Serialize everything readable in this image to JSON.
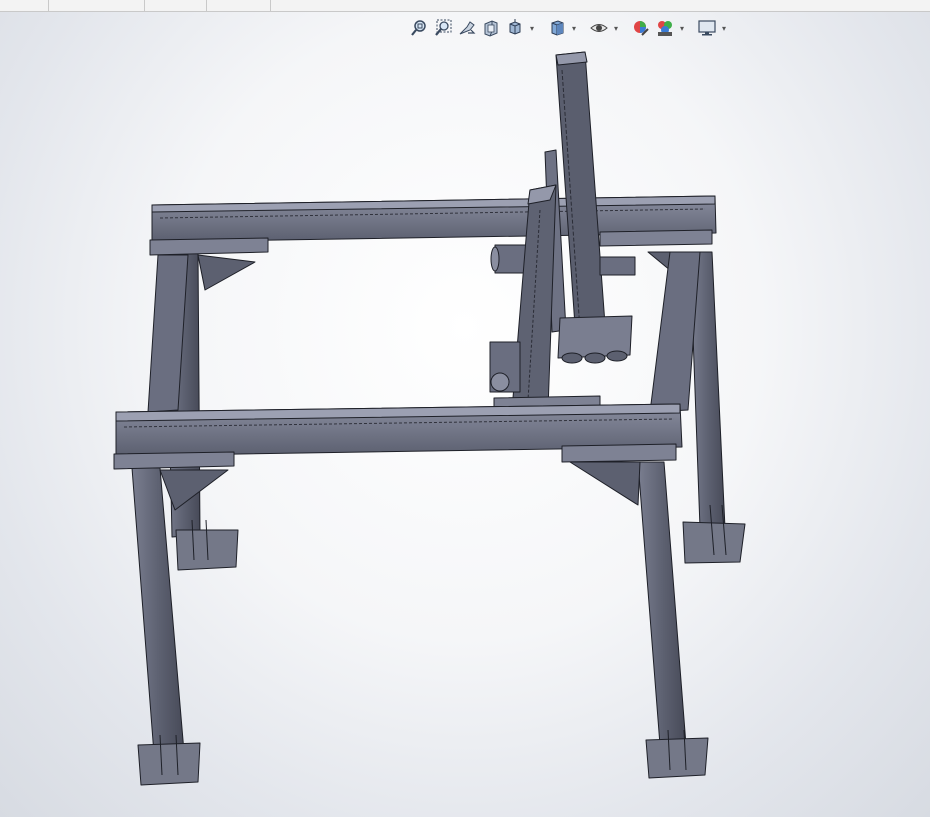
{
  "viewport": {
    "background_top": "#ffffff",
    "background_bottom": "#d7dbe2",
    "model_color": "#5d6170"
  },
  "heads_up_toolbar": {
    "items": [
      {
        "name": "zoom-to-fit-icon",
        "dropdown": false
      },
      {
        "name": "zoom-to-area-icon",
        "dropdown": false
      },
      {
        "name": "previous-view-icon",
        "dropdown": false
      },
      {
        "name": "section-view-icon",
        "dropdown": false
      },
      {
        "name": "view-orientation-icon",
        "dropdown": true
      },
      {
        "name": "display-style-icon",
        "dropdown": true
      },
      {
        "name": "hide-show-items-icon",
        "dropdown": true
      },
      {
        "name": "edit-appearance-icon",
        "dropdown": false
      },
      {
        "name": "apply-scene-icon",
        "dropdown": true
      },
      {
        "name": "view-settings-icon",
        "dropdown": true
      }
    ]
  }
}
